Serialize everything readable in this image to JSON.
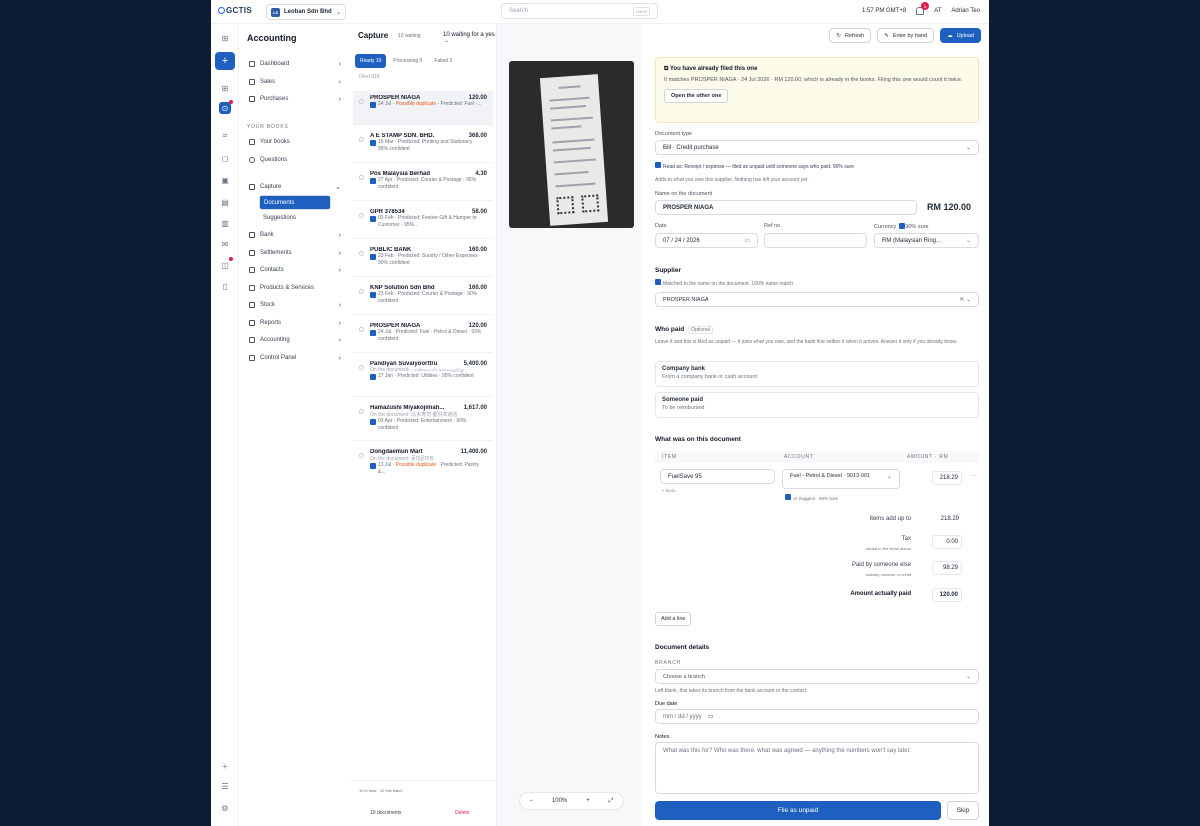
{
  "topbar": {
    "logo": "GCTIS",
    "org_initials": "LS",
    "org_name": "Leoban Sdn Bhd",
    "search_placeholder": "Search",
    "search_kbd": "Ctrl+K",
    "time": "1:57 PM GMT+8",
    "notif_count": "6",
    "user_initials": "AT",
    "user_name": "Adrian Teo"
  },
  "nav": {
    "title": "Accounting",
    "items": [
      "Dashboard",
      "Sales",
      "Purchases"
    ],
    "books_heading": "YOUR BOOKS",
    "books_items": [
      "Your books",
      "Questions"
    ],
    "capture": "Capture",
    "capture_sub": [
      "Documents",
      "Suggestions"
    ],
    "more": [
      "Bank",
      "Settlements",
      "Contacts",
      "Products & Services",
      "Stock",
      "Reports",
      "Accounting",
      "Control Panel"
    ]
  },
  "capture": {
    "title": "Capture",
    "waiting": "10 waiting",
    "waiting_long": "10 waiting for a yes →",
    "tabs": [
      "Ready 10",
      "Processing 0",
      "Failed 3"
    ],
    "filed": "Filed 818",
    "docs": [
      {
        "name": "PROSPER NIAGA",
        "amount": "120.00",
        "meta": "24 Jul · ",
        "dup": "Possible duplicate",
        "rest": " · Predicted: Fuel -..."
      },
      {
        "name": "A E STAMP SDN. BHD.",
        "amount": "368.00",
        "meta": "16 Mar · Predicted: Printing and Stationery · 95% confident"
      },
      {
        "name": "Pos Malaysia Berhad",
        "amount": "4.30",
        "meta": "27 Apr · Predicted: Courier & Postage · 95% confident"
      },
      {
        "name": "GPR 378534",
        "amount": "58.00",
        "meta": "03 Feb · Predicted: Festive Gift & Hamper to Customer · 95%..."
      },
      {
        "name": "PUBLIC BANK",
        "amount": "160.00",
        "meta": "23 Feb · Predicted: Sundry / Other Expenses · 90% confident"
      },
      {
        "name": "KNP Solution Sdn Bhd",
        "amount": "160.00",
        "meta": "23 Feb · Predicted: Courier & Postage · 90% confident"
      },
      {
        "name": "PROSPER NIAGA",
        "amount": "120.00",
        "meta": "24 Jul · Predicted: Fuel - Petrol & Diesel · 93% confident"
      },
      {
        "name": "Pandiyan Suvaiyoorttru",
        "amount": "5,400.00",
        "ondoc": "On the document: பாண்டியன் சுவையூற்று",
        "meta": "27 Jan · Predicted: Utilities · 95% confident"
      },
      {
        "name": "Hamazushi Miyakojimah...",
        "amount": "1,617.00",
        "ondoc": "On the document: はま寿司 都島本通店",
        "meta": "03 Apr · Predicted: Entertainment · 90% confident"
      },
      {
        "name": "Dongdaemun Mart",
        "amount": "11,400.00",
        "ondoc": "On the document: 동대문마트",
        "meta": "13 Jul · ",
        "dup": "Possible duplicate",
        "rest": " · Predicted: Pantry &..."
      }
    ],
    "foot_total": "10 in total · 10 this batch",
    "foot_count": "10 documents",
    "foot_delete": "Delete"
  },
  "viewer": {
    "zoom": "100%",
    "minus": "−",
    "plus": "+"
  },
  "actions": {
    "refresh": "Refresh",
    "enter": "Enter by hand",
    "upload": "Upload"
  },
  "warning": {
    "title": "You have already filed this one",
    "text": "It matches PROSPER NIAGA · 24 Jul 2026 · RM 120.00, which is already in the books. Filing this one would count it twice.",
    "button": "Open the other one"
  },
  "form": {
    "doc_type_label": "Document type",
    "doc_type": "Bill · Credit purchase",
    "read_as": "Read as: Receipt / expense — filed as unpaid until someone says who paid. 90% sure",
    "adds": "Adds to what you owe this supplier. Nothing has left your account yet.",
    "name_label": "Name on the document",
    "name": "PROSPER NIAGA",
    "total": "RM 120.00",
    "date_label": "Date",
    "date": "07 / 24 / 2026",
    "ref_label": "Ref no.",
    "currency_label": "Currency",
    "currency_sure": "90% sure",
    "currency": "RM (Malaysian Ring...",
    "supplier_h": "Supplier",
    "supplier_note": "Matched to the name on the document. 100% name match",
    "supplier": "PROSPER NIAGA",
    "whopaid_h": "Who paid",
    "optional": "Optional",
    "whopaid_text": "Leave it and this is filed as unpaid — it joins what you owe, and the bank line settles it when it arrives. Answer it only if you already know.",
    "opt1_a": "Company bank",
    "opt1_b": "From a company bank or cash account",
    "opt2_a": "Someone paid",
    "opt2_b": "To be reimbursed",
    "lines_h": "What was on this document",
    "col_item": "ITEM",
    "col_account": "ACCOUNT",
    "col_amount": "AMOUNT · RM",
    "item": "FuelSave 95",
    "item_sub": "+ 90.00",
    "account": "Fuel - Petrol & Diesel · 9013-001",
    "ai": "AI Suggest · 95% sure",
    "line_amt": "218.29",
    "t1": "Items add up to",
    "t1v": "218.29",
    "t2": "Tax",
    "t2s": "added to the items above",
    "t2v": "0.00",
    "t3": "Paid by someone else",
    "t3s": "subsidy, voucher or credit",
    "t3v": "98.29",
    "t4": "Amount actually paid",
    "t4v": "120.00",
    "addline": "Add a line",
    "details_h": "Document details",
    "branch_label": "BRANCH",
    "branch": "Choose a branch",
    "branch_note": "Left blank, this takes its branch from the bank account or the contact.",
    "due_label": "Due date",
    "due": "mm / dd / yyyy",
    "notes_label": "Notes",
    "notes_ph": "What was this for? Who was there, what was agreed — anything the numbers won't say later.",
    "file": "File as unpaid",
    "skip": "Skip"
  }
}
